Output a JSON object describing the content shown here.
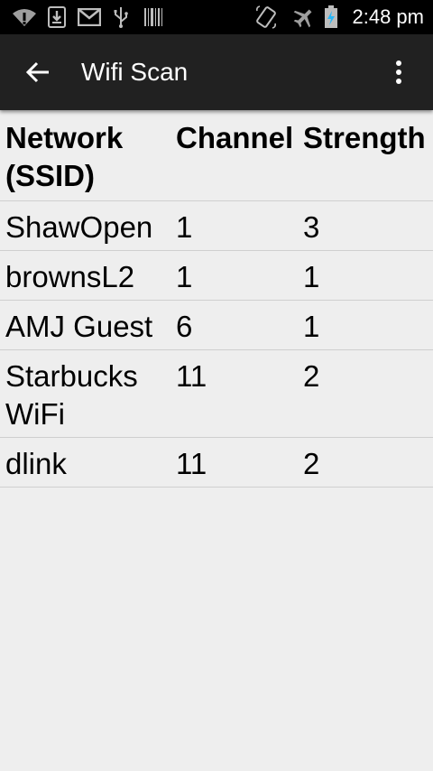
{
  "status_bar": {
    "time": "2:48 pm",
    "left_icons": [
      "wifi-alert-icon",
      "download-icon",
      "gmail-icon",
      "usb-icon",
      "barcode-icon"
    ],
    "right_icons": [
      "screen-rotate-icon",
      "airplane-mode-icon",
      "battery-charging-icon"
    ]
  },
  "app_bar": {
    "title": "Wifi Scan",
    "back_icon": "arrow-back-icon",
    "menu_icon": "more-vert-icon",
    "background": "#212121"
  },
  "table": {
    "headers": [
      "Network (SSID)",
      "Channel",
      "Strength"
    ],
    "header_ssid_line1": "Network",
    "header_ssid_line2": "(SSID)",
    "rows": [
      {
        "ssid": "ShawOpen",
        "channel": "1",
        "strength": "3"
      },
      {
        "ssid": "brownsL2",
        "channel": "1",
        "strength": "1"
      },
      {
        "ssid": "AMJ Guest",
        "channel": "6",
        "strength": "1"
      },
      {
        "ssid": "Starbucks WiFi",
        "channel": "11",
        "strength": "2"
      },
      {
        "ssid": "dlink",
        "channel": "11",
        "strength": "2"
      }
    ]
  }
}
